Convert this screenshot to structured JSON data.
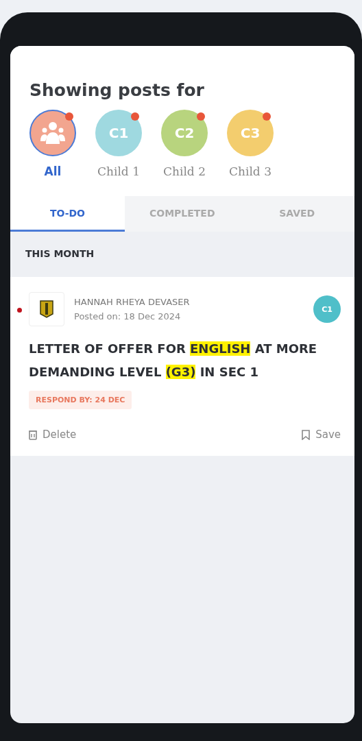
{
  "header": {
    "title": "Showing posts for"
  },
  "children": [
    {
      "label": "All",
      "kind": "group",
      "selected": true,
      "color": "#f2a58f",
      "unread": true
    },
    {
      "label": "Child 1",
      "kind": "initials",
      "initials": "C1",
      "selected": false,
      "color": "#9fd9e0",
      "unread": true
    },
    {
      "label": "Child 2",
      "kind": "initials",
      "initials": "C2",
      "selected": false,
      "color": "#b8d47e",
      "unread": true
    },
    {
      "label": "Child 3",
      "kind": "initials",
      "initials": "C3",
      "selected": false,
      "color": "#f3cd6e",
      "unread": true
    }
  ],
  "tabs": [
    {
      "label": "TO-DO",
      "selected": true
    },
    {
      "label": "COMPLETED",
      "selected": false
    },
    {
      "label": "SAVED",
      "selected": false
    }
  ],
  "section": {
    "title": "THIS MONTH"
  },
  "posts": [
    {
      "unread": true,
      "author": "HANNAH RHEYA DEVASER",
      "posted": "Posted on: 18 Dec 2024",
      "child_tag": "C1",
      "color": "#4fbfc9",
      "title_parts": [
        {
          "text": "LETTER OF OFFER FOR ",
          "highlight": false
        },
        {
          "text": "ENGLISH",
          "highlight": true
        },
        {
          "text": " AT MORE DEMANDING LEVEL ",
          "highlight": false
        },
        {
          "text": "(G3)",
          "highlight": true
        },
        {
          "text": " IN SEC 1",
          "highlight": false
        }
      ],
      "respond_by": "RESPOND BY: 24 DEC",
      "delete_label": "Delete",
      "save_label": "Save"
    }
  ]
}
